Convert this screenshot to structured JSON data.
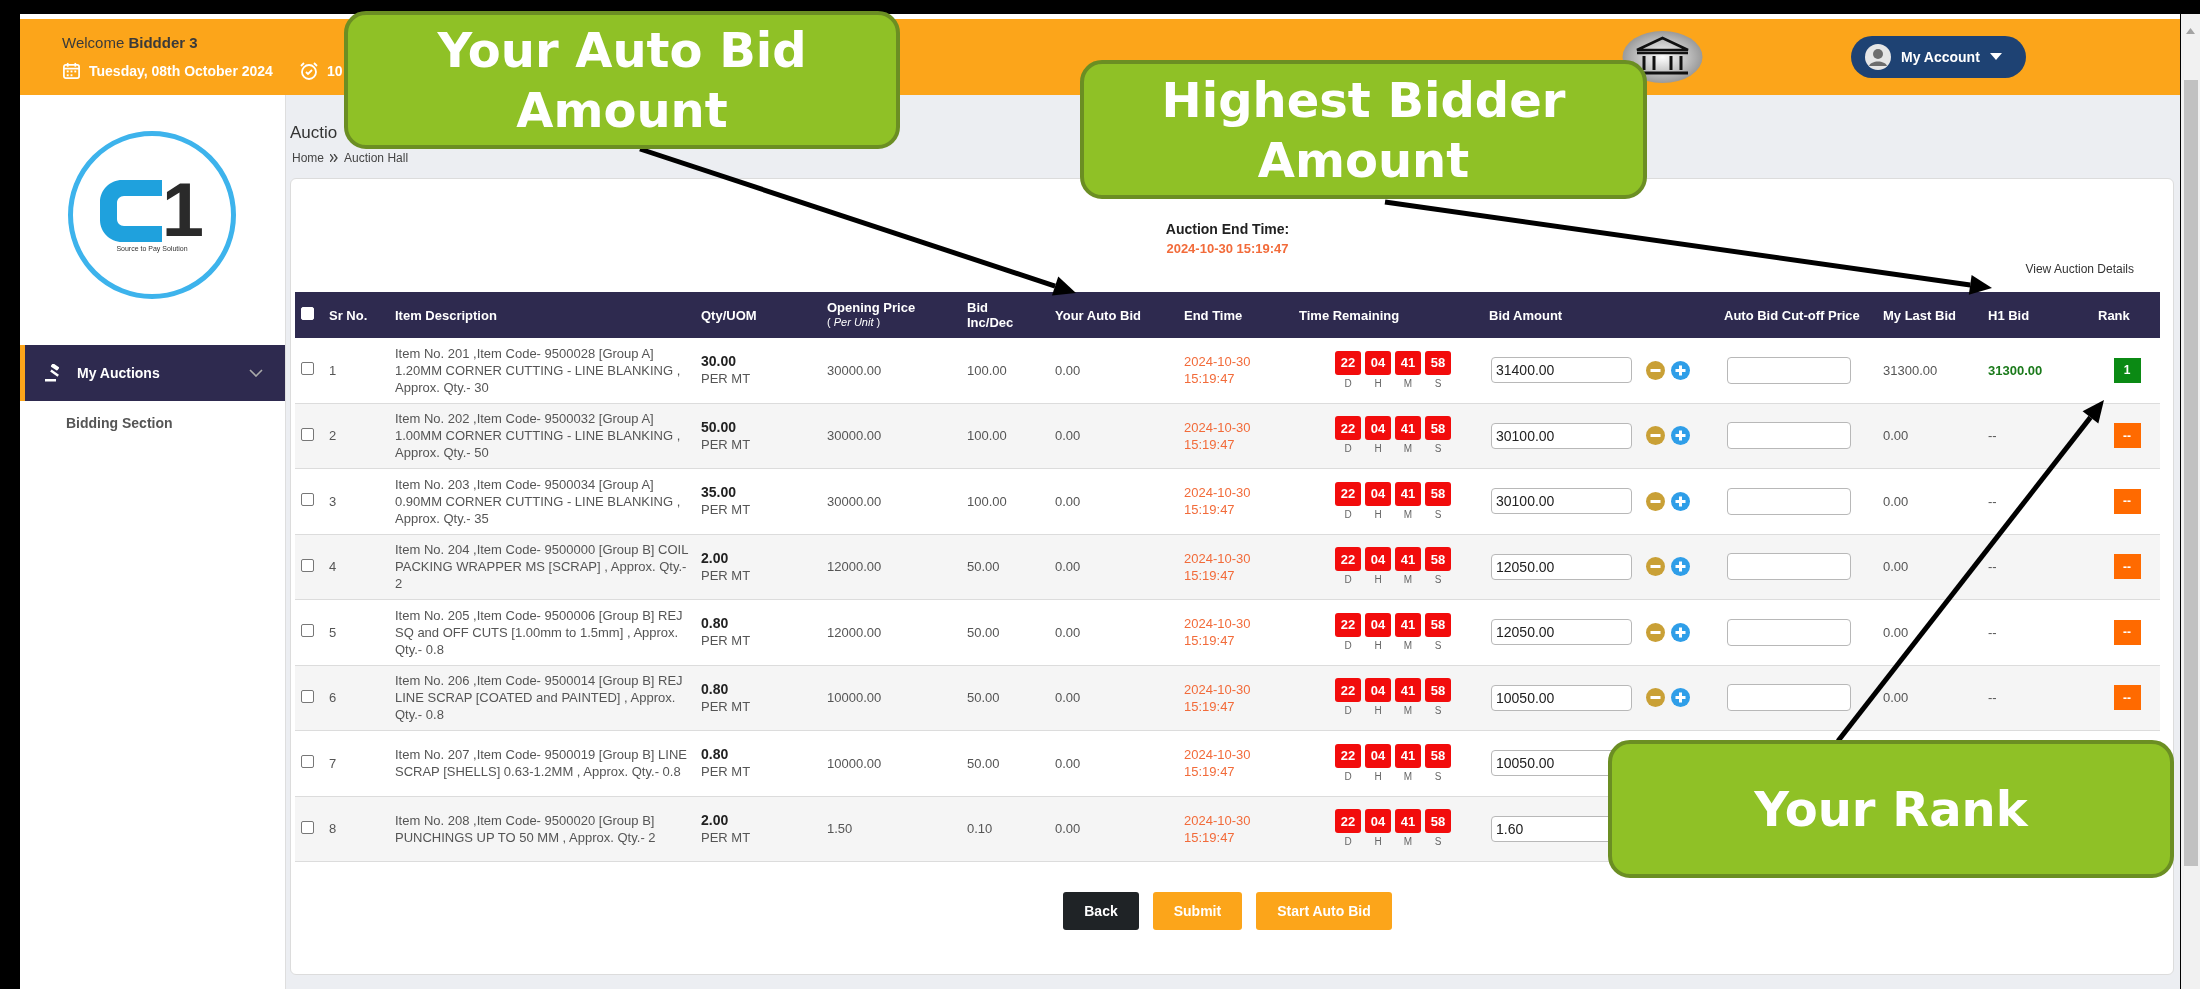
{
  "header": {
    "welcome": "Welcome **Biddder 3**",
    "date": "Tuesday, 08th October 2024",
    "time": "10",
    "account": "My Account"
  },
  "sidebar": {
    "logo_mark": "1",
    "logo_tagline": "Source to Pay Solution",
    "items": [
      {
        "label": "My Auctions",
        "selected": true,
        "expanded": true,
        "children": [
          {
            "label": "Bidding Section",
            "selected": false
          }
        ]
      }
    ]
  },
  "page": {
    "title": "Auctio",
    "breadcrumb": [
      "Home",
      "Auction Hall"
    ]
  },
  "auction_end": {
    "label": "Auction End Time:",
    "value": "2024-10-30 15:19:47"
  },
  "details_link": "View Auction Details",
  "table": {
    "select_all": {
      "checked": false
    },
    "columns": [
      {
        "label": "Sr No."
      },
      {
        "label": "Item Description"
      },
      {
        "label": "Qty/UOM"
      },
      {
        "label": "Opening Price",
        "sublabel": "( *Per Unit* )"
      },
      {
        "label": "Bid Inc/Dec"
      },
      {
        "label": "Your Auto Bid"
      },
      {
        "label": "End Time"
      },
      {
        "label": "Time Remaining"
      },
      {
        "label": "Bid Amount"
      },
      {
        "label": "Auto Bid Cut-off Price"
      },
      {
        "label": "My Last Bid"
      },
      {
        "label": "H1 Bid"
      },
      {
        "label": "Rank"
      }
    ],
    "rows": [
      {
        "checked": false,
        "sr": "1",
        "description": "Item No. 201 ,Item Code- 9500028 [Group A] 1.20MM CORNER CUTTING - LINE BLANKING , Approx. Qty.- 30",
        "qty": "30.00",
        "uom": "PER MT",
        "opening": "30000.00",
        "inc": "100.00",
        "auto_bid": "0.00",
        "end": "2024-10-30 15:19:47",
        "timer": [
          {
            "value": "22",
            "unit": "D"
          },
          {
            "value": "04",
            "unit": "H"
          },
          {
            "value": "41",
            "unit": "M"
          },
          {
            "value": "58",
            "unit": "S"
          }
        ],
        "bid": "31400.00",
        "kind": "full",
        "last_bid": "31300.00",
        "h1": "31300.00",
        "h1_leading": true,
        "rank": {
          "text": "1",
          "color": "#0b8a14"
        }
      },
      {
        "checked": false,
        "sr": "2",
        "description": "Item No. 202 ,Item Code- 9500032 [Group A] 1.00MM CORNER CUTTING - LINE BLANKING , Approx. Qty.- 50",
        "qty": "50.00",
        "uom": "PER MT",
        "opening": "30000.00",
        "inc": "100.00",
        "auto_bid": "0.00",
        "end": "2024-10-30 15:19:47",
        "timer": [
          {
            "value": "22",
            "unit": "D"
          },
          {
            "value": "04",
            "unit": "H"
          },
          {
            "value": "41",
            "unit": "M"
          },
          {
            "value": "58",
            "unit": "S"
          }
        ],
        "bid": "30100.00",
        "kind": "full",
        "last_bid": "0.00",
        "h1": "--",
        "h1_leading": false,
        "rank": {
          "text": "--",
          "color": "#ff6a00"
        }
      },
      {
        "checked": false,
        "sr": "3",
        "description": "Item No. 203 ,Item Code- 9500034 [Group A] 0.90MM CORNER CUTTING - LINE BLANKING , Approx. Qty.- 35",
        "qty": "35.00",
        "uom": "PER MT",
        "opening": "30000.00",
        "inc": "100.00",
        "auto_bid": "0.00",
        "end": "2024-10-30 15:19:47",
        "timer": [
          {
            "value": "22",
            "unit": "D"
          },
          {
            "value": "04",
            "unit": "H"
          },
          {
            "value": "41",
            "unit": "M"
          },
          {
            "value": "58",
            "unit": "S"
          }
        ],
        "bid": "30100.00",
        "kind": "full",
        "last_bid": "0.00",
        "h1": "--",
        "h1_leading": false,
        "rank": {
          "text": "--",
          "color": "#ff6a00"
        }
      },
      {
        "checked": false,
        "sr": "4",
        "description": "Item No. 204 ,Item Code- 9500000 [Group B] COIL PACKING WRAPPER MS [SCRAP] , Approx. Qty.- 2",
        "qty": "2.00",
        "uom": "PER MT",
        "opening": "12000.00",
        "inc": "50.00",
        "auto_bid": "0.00",
        "end": "2024-10-30 15:19:47",
        "timer": [
          {
            "value": "22",
            "unit": "D"
          },
          {
            "value": "04",
            "unit": "H"
          },
          {
            "value": "41",
            "unit": "M"
          },
          {
            "value": "58",
            "unit": "S"
          }
        ],
        "bid": "12050.00",
        "kind": "full",
        "last_bid": "0.00",
        "h1": "--",
        "h1_leading": false,
        "rank": {
          "text": "--",
          "color": "#ff6a00"
        }
      },
      {
        "checked": false,
        "sr": "5",
        "description": "Item No. 205 ,Item Code- 9500006 [Group B] REJ SQ and OFF CUTS [1.00mm to 1.5mm] , Approx. Qty.- 0.8",
        "qty": "0.80",
        "uom": "PER MT",
        "opening": "12000.00",
        "inc": "50.00",
        "auto_bid": "0.00",
        "end": "2024-10-30 15:19:47",
        "timer": [
          {
            "value": "22",
            "unit": "D"
          },
          {
            "value": "04",
            "unit": "H"
          },
          {
            "value": "41",
            "unit": "M"
          },
          {
            "value": "58",
            "unit": "S"
          }
        ],
        "bid": "12050.00",
        "kind": "full",
        "last_bid": "0.00",
        "h1": "--",
        "h1_leading": false,
        "rank": {
          "text": "--",
          "color": "#ff6a00"
        }
      },
      {
        "checked": false,
        "sr": "6",
        "description": "Item No. 206 ,Item Code- 9500014 [Group B] REJ LINE SCRAP [COATED and PAINTED] , Approx. Qty.- 0.8",
        "qty": "0.80",
        "uom": "PER MT",
        "opening": "10000.00",
        "inc": "50.00",
        "auto_bid": "0.00",
        "end": "2024-10-30 15:19:47",
        "timer": [
          {
            "value": "22",
            "unit": "D"
          },
          {
            "value": "04",
            "unit": "H"
          },
          {
            "value": "41",
            "unit": "M"
          },
          {
            "value": "58",
            "unit": "S"
          }
        ],
        "bid": "10050.00",
        "kind": "full",
        "last_bid": "0.00",
        "h1": "--",
        "h1_leading": false,
        "rank": {
          "text": "--",
          "color": "#ff6a00"
        }
      },
      {
        "checked": false,
        "sr": "7",
        "description": "Item No. 207 ,Item Code- 9500019 [Group B] LINE SCRAP [SHELLS] 0.63-1.2MM , Approx. Qty.- 0.8",
        "qty": "0.80",
        "uom": "PER MT",
        "opening": "10000.00",
        "inc": "50.00",
        "auto_bid": "0.00",
        "end": "2024-10-30 15:19:47",
        "timer": [
          {
            "value": "22",
            "unit": "D"
          },
          {
            "value": "04",
            "unit": "H"
          },
          {
            "value": "41",
            "unit": "M"
          },
          {
            "value": "58",
            "unit": "S"
          }
        ],
        "bid": "10050.00",
        "kind": "partial"
      },
      {
        "checked": false,
        "sr": "8",
        "description": "Item No. 208 ,Item Code- 9500020 [Group B] PUNCHINGS UP TO 50 MM , Approx. Qty.- 2",
        "qty": "2.00",
        "uom": "PER MT",
        "opening": "1.50",
        "inc": "0.10",
        "auto_bid": "0.00",
        "end": "2024-10-30 15:19:47",
        "timer": [
          {
            "value": "22",
            "unit": "D"
          },
          {
            "value": "04",
            "unit": "H"
          },
          {
            "value": "41",
            "unit": "M"
          },
          {
            "value": "58",
            "unit": "S"
          }
        ],
        "bid": "1.60",
        "kind": "partial"
      }
    ]
  },
  "buttons": [
    {
      "label": "Back",
      "kind": "dark"
    },
    {
      "label": "Submit",
      "kind": "primary"
    },
    {
      "label": "Start Auto Bid",
      "kind": "primary"
    }
  ],
  "callouts": [
    {
      "text": "Your Auto Bid Amount"
    },
    {
      "text": "Highest Bidder Amount"
    },
    {
      "text": "Your Rank"
    }
  ]
}
